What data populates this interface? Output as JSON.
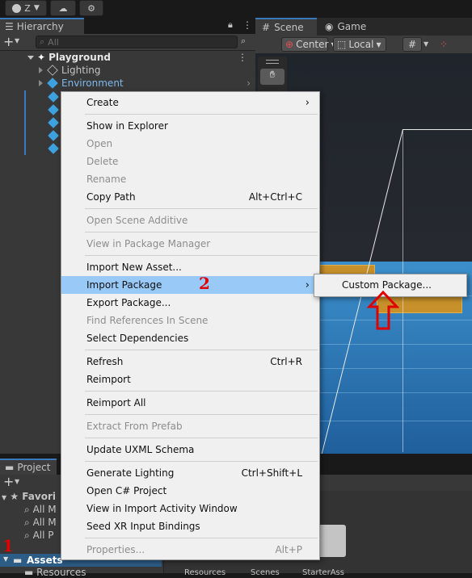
{
  "toolbar": {
    "account_label": "Z"
  },
  "hierarchy": {
    "tab_label": "Hierarchy",
    "search_placeholder": "All",
    "root": "Playground",
    "items": [
      "Lighting",
      "Environment"
    ]
  },
  "scene": {
    "tabs": [
      "Scene",
      "Game"
    ],
    "pivot_mode": "Center",
    "pivot_rotation": "Local"
  },
  "project": {
    "tab_label": "Project",
    "favorites_label": "Favori",
    "favorites": [
      "All M",
      "All M",
      "All P"
    ],
    "assets_label": "Assets",
    "resources_label": "Resources",
    "bottom_labels": [
      "Resources",
      "Scenes",
      "StarterAss"
    ]
  },
  "context_menu": {
    "items": {
      "create": "Create",
      "show_in_explorer": "Show in Explorer",
      "open": "Open",
      "delete": "Delete",
      "rename": "Rename",
      "copy_path": "Copy Path",
      "copy_path_shortcut": "Alt+Ctrl+C",
      "open_scene_additive": "Open Scene Additive",
      "view_in_package_manager": "View in Package Manager",
      "import_new_asset": "Import New Asset...",
      "import_package": "Import Package",
      "export_package": "Export Package...",
      "find_references": "Find References In Scene",
      "select_dependencies": "Select Dependencies",
      "refresh": "Refresh",
      "refresh_shortcut": "Ctrl+R",
      "reimport": "Reimport",
      "reimport_all": "Reimport All",
      "extract_from_prefab": "Extract From Prefab",
      "update_uxml_schema": "Update UXML Schema",
      "generate_lighting": "Generate Lighting",
      "generate_lighting_shortcut": "Ctrl+Shift+L",
      "open_csharp_project": "Open C# Project",
      "view_in_import_activity": "View in Import Activity Window",
      "seed_xr_input_bindings": "Seed XR Input Bindings",
      "properties": "Properties...",
      "properties_shortcut": "Alt+P"
    }
  },
  "submenu": {
    "custom_package": "Custom Package..."
  },
  "annotations": {
    "step1": "1",
    "step2": "2"
  },
  "colors": {
    "highlight": "#99c9f7",
    "annotation": "#e00000",
    "accent": "#3a79bb"
  }
}
